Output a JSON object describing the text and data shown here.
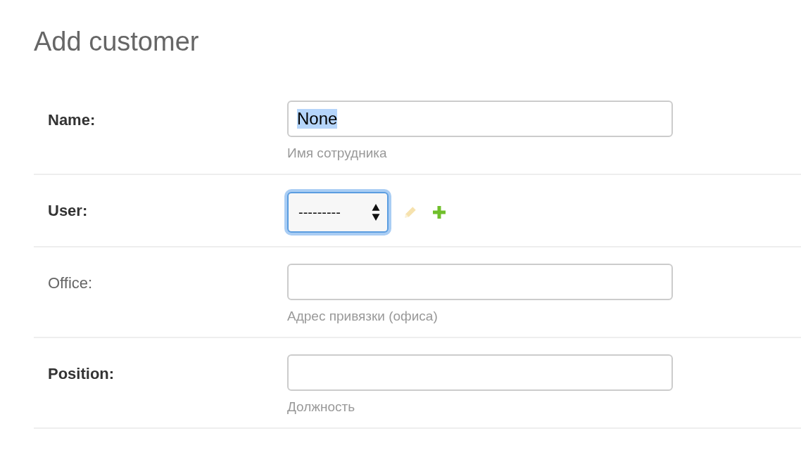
{
  "title": "Add customer",
  "fields": [
    {
      "kind": "text",
      "label": "Name:",
      "required": true,
      "value": "None",
      "value_selected": true,
      "focused": false,
      "help": "Имя сотрудника"
    },
    {
      "kind": "select",
      "label": "User:",
      "required": true,
      "value": "---------",
      "focused": true,
      "edit_disabled": true
    },
    {
      "kind": "text",
      "label": "Office:",
      "required": false,
      "focused": false,
      "help": "Адрес привязки (офиса)"
    },
    {
      "kind": "text",
      "label": "Position:",
      "required": true,
      "focused": false,
      "help": "Должность"
    }
  ]
}
